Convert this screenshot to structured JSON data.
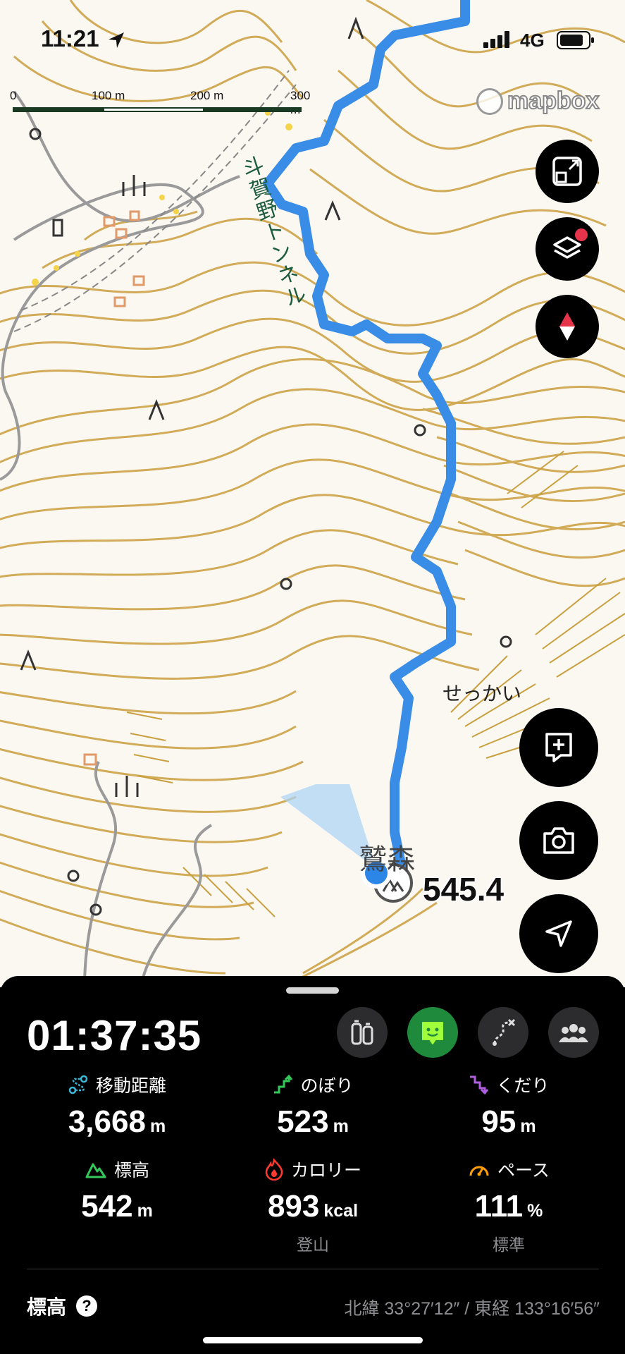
{
  "status_bar": {
    "time": "11:21",
    "network": "4G"
  },
  "map": {
    "scale_labels": [
      "0",
      "100 m",
      "200 m",
      "300 m"
    ],
    "attribution": "mapbox",
    "tunnel_label": "斗賀野トンネル",
    "place_label": "せっかい",
    "peak_label": "鷲森",
    "peak_elevation": "545.4",
    "route_color": "#3a8de6",
    "contour_color": "#c9a040"
  },
  "map_controls": [
    {
      "name": "expand-icon"
    },
    {
      "name": "layers-icon"
    },
    {
      "name": "compass-icon"
    },
    {
      "name": "add-note-icon"
    },
    {
      "name": "camera-icon"
    },
    {
      "name": "location-arrow-icon"
    }
  ],
  "panel": {
    "timer": "01:37:35",
    "mode_buttons": [
      {
        "name": "gear-items-icon",
        "active": false
      },
      {
        "name": "smile-face-icon",
        "active": true
      },
      {
        "name": "route-icon",
        "active": false
      },
      {
        "name": "group-icon",
        "active": false
      }
    ],
    "stats": [
      {
        "label": "移動距離",
        "value": "3,668",
        "unit": "m",
        "icon": "distance-icon",
        "icon_color": "#3ab8d8"
      },
      {
        "label": "のぼり",
        "value": "523",
        "unit": "m",
        "icon": "ascent-icon",
        "icon_color": "#34c759"
      },
      {
        "label": "くだり",
        "value": "95",
        "unit": "m",
        "icon": "descent-icon",
        "icon_color": "#b05fe0"
      },
      {
        "label": "標高",
        "value": "542",
        "unit": "m",
        "icon": "mountain-icon",
        "icon_color": "#34c759"
      },
      {
        "label": "カロリー",
        "value": "893",
        "unit": "kcal",
        "sub": "登山",
        "icon": "fire-icon",
        "icon_color": "#ff3b30"
      },
      {
        "label": "ペース",
        "value": "111",
        "unit": "%",
        "sub": "標準",
        "icon": "speed-icon",
        "icon_color": "#ff9f0a"
      }
    ],
    "elevation_title": "標高",
    "coordinates": "北緯 33°27′12″ / 東経 133°16′56″"
  }
}
